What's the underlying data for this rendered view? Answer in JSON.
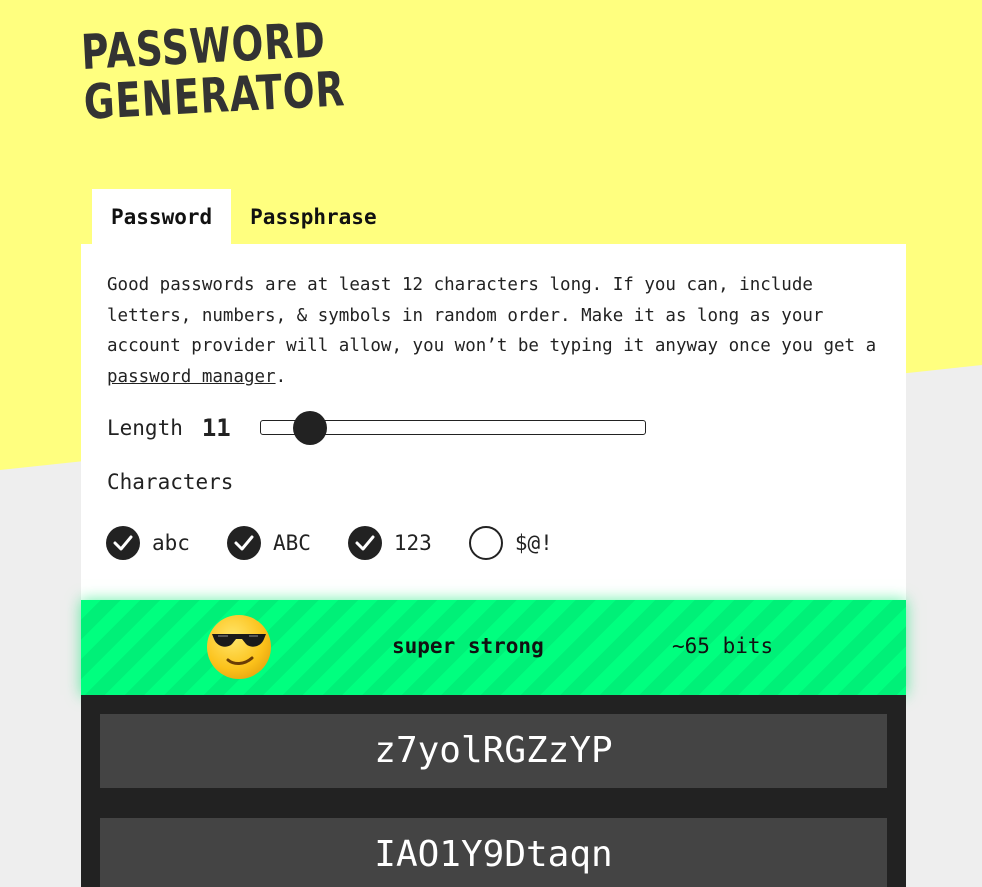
{
  "app": {
    "logo_line1": "PASSWORD",
    "logo_line2": "GENERATOR"
  },
  "tabs": [
    {
      "label": "Password",
      "active": true
    },
    {
      "label": "Passphrase",
      "active": false
    }
  ],
  "intro": {
    "text_before_link": "Good passwords are at least 12 characters long. If you can, include letters, numbers, & symbols in random order. Make it as long as your account provider will allow, you won’t be typing it anyway once you get a ",
    "link_text": "password manager",
    "text_after_link": "."
  },
  "length": {
    "label": "Length",
    "value": "11",
    "slider_fraction": 0.128
  },
  "characters": {
    "label": "Characters",
    "options": [
      {
        "label": "abc",
        "checked": true
      },
      {
        "label": "ABC",
        "checked": true
      },
      {
        "label": "123",
        "checked": true
      },
      {
        "label": "$@!",
        "checked": false
      }
    ]
  },
  "strength": {
    "emoji": "sunglasses-face-icon",
    "label": "super strong",
    "bits": "~65 bits",
    "color": "#00ff7f"
  },
  "passwords": [
    "z7yolRGZzYP",
    "IAO1Y9Dtaqn"
  ],
  "colors": {
    "yellow": "#ffff7f",
    "gray_bg": "#eeeeee",
    "dark": "#222222",
    "pw_box": "#444444"
  }
}
